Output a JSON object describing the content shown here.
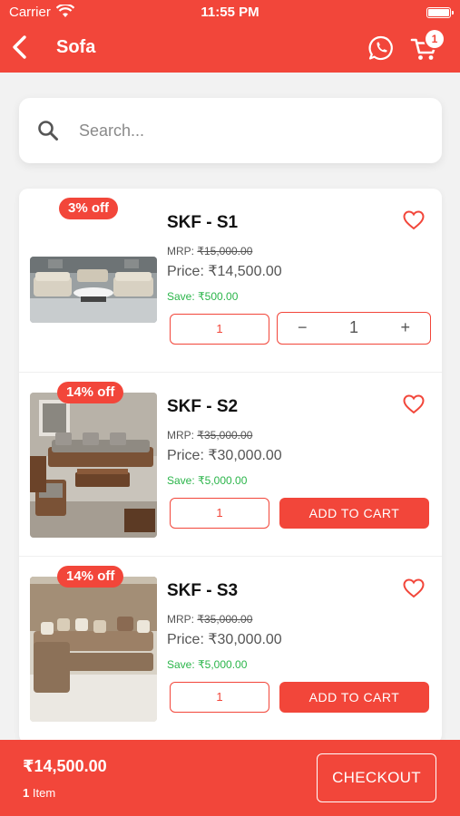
{
  "status_bar": {
    "carrier": "Carrier",
    "time": "11:55 PM"
  },
  "header": {
    "title": "Sofa",
    "cart_count": "1"
  },
  "search": {
    "placeholder": "Search..."
  },
  "products": [
    {
      "discount": "3% off",
      "name": "SKF - S1",
      "mrp_label": "MRP: ",
      "mrp": "₹15,000.00",
      "price_label": "Price: ",
      "price": "₹14,500.00",
      "save_label": "Save: ",
      "save": "₹500.00",
      "qty": "1",
      "stepper": {
        "minus": "−",
        "value": "1",
        "plus": "+"
      }
    },
    {
      "discount": "14% off",
      "name": "SKF - S2",
      "mrp_label": "MRP: ",
      "mrp": "₹35,000.00",
      "price_label": "Price: ",
      "price": "₹30,000.00",
      "save_label": "Save: ",
      "save": "₹5,000.00",
      "qty": "1",
      "action": "ADD TO CART"
    },
    {
      "discount": "14% off",
      "name": "SKF - S3",
      "mrp_label": "MRP: ",
      "mrp": "₹35,000.00",
      "price_label": "Price: ",
      "price": "₹30,000.00",
      "save_label": "Save: ",
      "save": "₹5,000.00",
      "qty": "1",
      "action": "ADD TO CART"
    }
  ],
  "footer": {
    "total": "₹14,500.00",
    "item_count": "1",
    "item_label": "Item",
    "checkout": "CHECKOUT"
  },
  "colors": {
    "accent": "#f2463a",
    "save_green": "#2bb54a"
  }
}
